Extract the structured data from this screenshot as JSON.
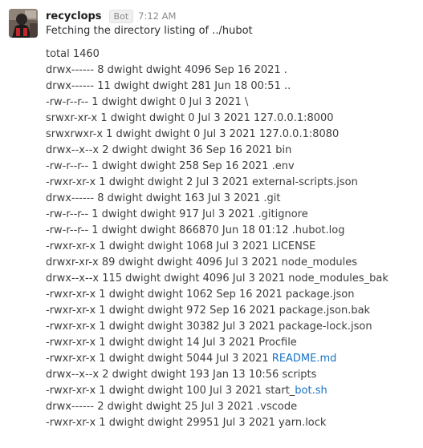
{
  "message": {
    "username": "recyclops",
    "badge": "Bot",
    "timestamp": "7:12 AM",
    "intro": "Fetching the directory listing of ../hubot"
  },
  "listing": [
    {
      "text": "total 1460"
    },
    {
      "text": "drwx------ 8 dwight dwight 4096 Sep 16 2021 ."
    },
    {
      "text": "drwx------ 11 dwight dwight 281 Jun 18 00:51 .."
    },
    {
      "text": "-rw-r--r-- 1 dwight dwight 0 Jul 3 2021 \\"
    },
    {
      "text": "srwxr-xr-x 1 dwight dwight 0 Jul 3 2021 127.0.0.1:8000"
    },
    {
      "text": "srwxrwxr-x 1 dwight dwight 0 Jul 3 2021 127.0.0.1:8080"
    },
    {
      "text": "drwx--x--x 2 dwight dwight 36 Sep 16 2021 bin"
    },
    {
      "text": "-rw-r--r-- 1 dwight dwight 258 Sep 16 2021 .env"
    },
    {
      "text": "-rwxr-xr-x 1 dwight dwight 2 Jul 3 2021 external-scripts.json"
    },
    {
      "text": "drwx------ 8 dwight dwight 163 Jul 3 2021 .git"
    },
    {
      "text": "-rw-r--r-- 1 dwight dwight 917 Jul 3 2021 .gitignore"
    },
    {
      "text": "-rw-r--r-- 1 dwight dwight 866870 Jun 18 01:12 .hubot.log"
    },
    {
      "text": "-rwxr-xr-x 1 dwight dwight 1068 Jul 3 2021 LICENSE"
    },
    {
      "text": "drwxr-xr-x 89 dwight dwight 4096 Jul 3 2021 node_modules"
    },
    {
      "text": "drwx--x--x 115 dwight dwight 4096 Jul 3 2021 node_modules_bak"
    },
    {
      "text": "-rwxr-xr-x 1 dwight dwight 1062 Sep 16 2021 package.json"
    },
    {
      "text": "-rwxr-xr-x 1 dwight dwight 972 Sep 16 2021 package.json.bak"
    },
    {
      "text": "-rwxr-xr-x 1 dwight dwight 30382 Jul 3 2021 package-lock.json"
    },
    {
      "text": "-rwxr-xr-x 1 dwight dwight 14 Jul 3 2021 Procfile"
    },
    {
      "text": "-rwxr-xr-x 1 dwight dwight 5044 Jul 3 2021 ",
      "link": "README.md"
    },
    {
      "text": "drwx--x--x 2 dwight dwight 193 Jan 13 10:56 scripts"
    },
    {
      "text": "-rwxr-xr-x 1 dwight dwight 100 Jul 3 2021 start_",
      "link": "bot.sh"
    },
    {
      "text": "drwx------ 2 dwight dwight 25 Jul 3 2021 .vscode"
    },
    {
      "text": "-rwxr-xr-x 1 dwight dwight 29951 Jul 3 2021 yarn.lock"
    }
  ],
  "colors": {
    "link": "#1a73c6",
    "username": "#1d1c1d",
    "meta": "#8a8a8a"
  }
}
